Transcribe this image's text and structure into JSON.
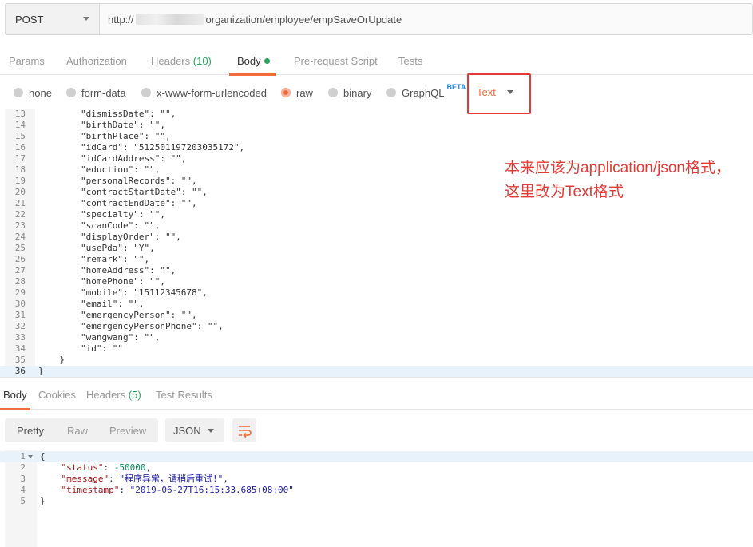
{
  "request": {
    "method": "POST",
    "url_prefix": "http://",
    "url_suffix": "organization/employee/empSaveOrUpdate"
  },
  "request_tabs": [
    {
      "label": "Params"
    },
    {
      "label": "Authorization"
    },
    {
      "label": "Headers",
      "count": "(10)"
    },
    {
      "label": "Body",
      "active": true
    },
    {
      "label": "Pre-request Script"
    },
    {
      "label": "Tests"
    }
  ],
  "body_types": {
    "none": "none",
    "form_data": "form-data",
    "urlencoded": "x-www-form-urlencoded",
    "raw": "raw",
    "binary": "binary",
    "graphql": "GraphQL",
    "beta": "BETA",
    "selected": "raw",
    "raw_format": "Text"
  },
  "request_body_lines": [
    {
      "n": "13",
      "code": "        \"dismissDate\": \"\","
    },
    {
      "n": "14",
      "code": "        \"birthDate\": \"\","
    },
    {
      "n": "15",
      "code": "        \"birthPlace\": \"\","
    },
    {
      "n": "16",
      "code": "        \"idCard\": \"512501197203035172\","
    },
    {
      "n": "17",
      "code": "        \"idCardAddress\": \"\","
    },
    {
      "n": "18",
      "code": "        \"eduction\": \"\","
    },
    {
      "n": "19",
      "code": "        \"personalRecords\": \"\","
    },
    {
      "n": "20",
      "code": "        \"contractStartDate\": \"\","
    },
    {
      "n": "21",
      "code": "        \"contractEndDate\": \"\","
    },
    {
      "n": "22",
      "code": "        \"specialty\": \"\","
    },
    {
      "n": "23",
      "code": "        \"scanCode\": \"\","
    },
    {
      "n": "24",
      "code": "        \"displayOrder\": \"\","
    },
    {
      "n": "25",
      "code": "        \"usePda\": \"Y\","
    },
    {
      "n": "26",
      "code": "        \"remark\": \"\","
    },
    {
      "n": "27",
      "code": "        \"homeAddress\": \"\","
    },
    {
      "n": "28",
      "code": "        \"homePhone\": \"\","
    },
    {
      "n": "29",
      "code": "        \"mobile\": \"15112345678\","
    },
    {
      "n": "30",
      "code": "        \"email\": \"\","
    },
    {
      "n": "31",
      "code": "        \"emergencyPerson\": \"\","
    },
    {
      "n": "32",
      "code": "        \"emergencyPersonPhone\": \"\","
    },
    {
      "n": "33",
      "code": "        \"wangwang\": \"\","
    },
    {
      "n": "34",
      "code": "        \"id\": \"\""
    },
    {
      "n": "35",
      "code": "    }"
    },
    {
      "n": "36",
      "code": "}"
    }
  ],
  "annotation": "本来应该为application/json格式，这里改为Text格式",
  "response_tabs": [
    {
      "label": "Body",
      "active": true
    },
    {
      "label": "Cookies"
    },
    {
      "label": "Headers",
      "count": "(5)"
    },
    {
      "label": "Test Results"
    }
  ],
  "response_toolbar": {
    "pretty": "Pretty",
    "raw": "Raw",
    "preview": "Preview",
    "format": "JSON"
  },
  "response_lines": [
    {
      "n": "1",
      "code": "{"
    },
    {
      "n": "2",
      "key": "\"status\"",
      "sep": ": ",
      "val": "-50000",
      "tail": ",",
      "type": "num"
    },
    {
      "n": "3",
      "key": "\"message\"",
      "sep": ": ",
      "val": "\"程序异常，请稍后重试!\"",
      "tail": ",",
      "type": "str"
    },
    {
      "n": "4",
      "key": "\"timestamp\"",
      "sep": ": ",
      "val": "\"2019-06-27T16:15:33.685+08:00\"",
      "tail": "",
      "type": "str"
    },
    {
      "n": "5",
      "code": "}"
    }
  ],
  "colors": {
    "accent": "#f26b3a",
    "count_green": "#26a65b",
    "annotation_red": "#e53935",
    "beta_blue": "#1e88d8"
  },
  "icons": {
    "method_caret": "chevron-down-icon",
    "format_caret": "chevron-down-icon",
    "wrap": "wrap-lines-icon",
    "fold": "fold-caret-icon"
  }
}
